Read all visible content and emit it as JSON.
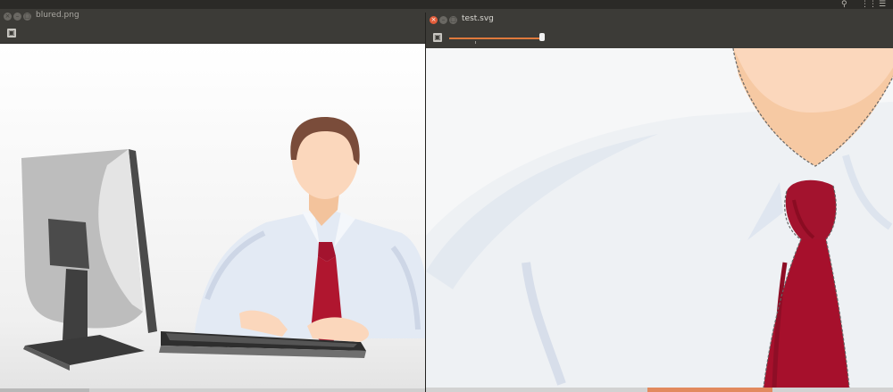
{
  "desktop": {
    "top_icons": [
      "search-icon",
      "grid-icon",
      "menu-icon"
    ]
  },
  "left_window": {
    "title": "blured.png",
    "toolbar_icon": "fit-icon"
  },
  "right_window": {
    "title": "test.svg",
    "zoom_slider_fraction": 0.85,
    "toolbar_icon": "fit-icon"
  },
  "colors": {
    "chrome": "#3c3b37",
    "accent": "#e0793c",
    "close": "#e25c3a"
  }
}
